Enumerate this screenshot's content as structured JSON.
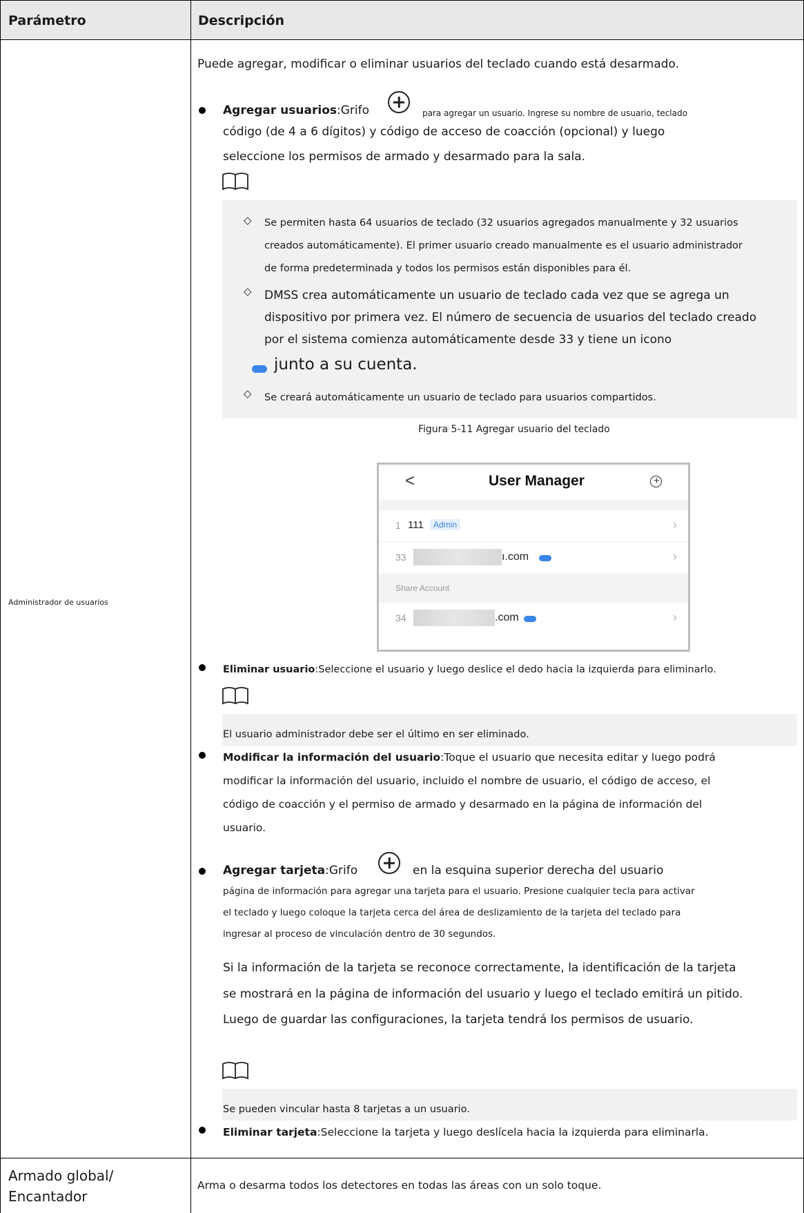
{
  "table": {
    "header_param": "Parámetro",
    "header_desc": "Descripción"
  },
  "row1": {
    "param": "Administrador de usuarios",
    "intro": "Puede agregar, modificar o eliminar usuarios del teclado cuando está desarmado.",
    "add_users": {
      "label": "Agregar usuarios",
      "pre": ":Grifo",
      "post_small": "para agregar un usuario. Ingrese su nombre de usuario, teclado",
      "line2": "código (de 4 a 6 dígitos) y código de acceso de coacción (opcional) y luego",
      "line3": "seleccione los permisos de armado y desarmado para la sala."
    },
    "note1": {
      "item1_l1": "Se permiten hasta 64 usuarios de teclado (32 usuarios agregados manualmente y 32 usuarios",
      "item1_l2": "creados automáticamente). El primer usuario creado manualmente es el usuario administrador",
      "item1_l3": "de forma predeterminada y todos los permisos están disponibles para él.",
      "item2_l1": "DMSS crea automáticamente un usuario de teclado cada vez que se agrega un",
      "item2_l2": "dispositivo por primera vez. El número de secuencia de usuarios del teclado creado",
      "item2_l3": "por el sistema comienza automáticamente desde 33 y tiene un icono",
      "item2_l4": "junto a su cuenta.",
      "item3": "Se creará automáticamente un usuario de teclado para usuarios compartidos."
    },
    "figure_caption": "Figura 5-11 Agregar usuario del teclado",
    "phone": {
      "title": "User Manager",
      "back": "<",
      "add": "+",
      "rows": [
        {
          "num": "1",
          "name": "111",
          "badge": "Admin"
        },
        {
          "num": "33",
          "suffix": "ı.com"
        },
        {
          "num": "34",
          "suffix": ".com"
        }
      ],
      "section": "Share Account"
    },
    "delete_user": {
      "label": "Eliminar usuario",
      "text": ":Seleccione el usuario y luego deslice el dedo hacia la izquierda para eliminarlo."
    },
    "note2": "El usuario administrador debe ser el último en ser eliminado.",
    "modify_user": {
      "label": "Modificar la información del usuario",
      "text_l1": ":Toque el usuario que necesita editar y luego podrá",
      "text_l2": "modificar la información del usuario, incluido el nombre de usuario, el código de acceso, el",
      "text_l3": "código de coacción y el permiso de armado y desarmado en la página de información del",
      "text_l4": "usuario."
    },
    "add_card": {
      "label": "Agregar tarjeta",
      "pre": ":Grifo",
      "post": "en la esquina superior derecha del usuario",
      "line2": "página de información para agregar una tarjeta para el usuario. Presione cualquier tecla para activar",
      "line3": "el teclado y luego coloque la tarjeta cerca del área de deslizamiento de la tarjeta del teclado para",
      "line4": "ingresar al proceso de vinculación dentro de 30 segundos.",
      "para_l1": "Si la información de la tarjeta se reconoce correctamente, la identificación de la tarjeta",
      "para_l2": "se mostrará en la página de información del usuario y luego el teclado emitirá un pitido.",
      "para_l3": "Luego de guardar las configuraciones, la tarjeta tendrá los permisos de usuario."
    },
    "note3": "Se pueden vincular hasta 8 tarjetas a un usuario.",
    "delete_card": {
      "label": "Eliminar tarjeta",
      "text": ":Seleccione la tarjeta y luego deslícela hacia la izquierda para eliminarla."
    }
  },
  "row2": {
    "param_l1": "Armado global/",
    "param_l2": "Encantador",
    "desc": "Arma o desarma todos los detectores en todas las áreas con un solo toque."
  }
}
